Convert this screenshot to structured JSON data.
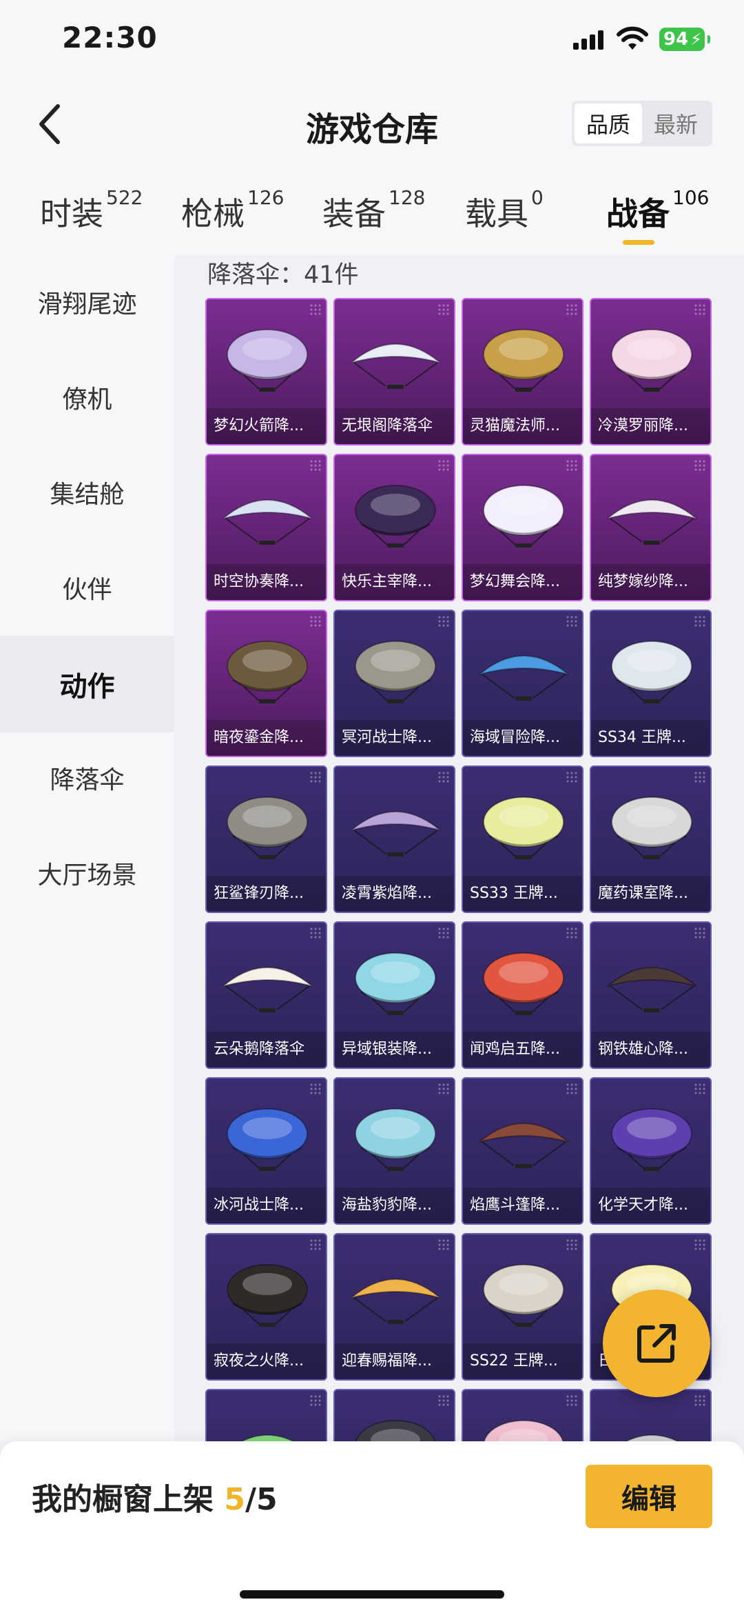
{
  "status": {
    "time": "22:30",
    "battery": "94"
  },
  "header": {
    "title": "游戏仓库",
    "sort_options": [
      "品质",
      "最新"
    ],
    "sort_active": 0
  },
  "tabs": [
    {
      "name": "时装",
      "count": "522"
    },
    {
      "name": "枪械",
      "count": "126"
    },
    {
      "name": "装备",
      "count": "128"
    },
    {
      "name": "载具",
      "count": "0"
    },
    {
      "name": "战备",
      "count": "106"
    }
  ],
  "active_tab": 4,
  "sidebar": {
    "items": [
      "滑翔尾迹",
      "僚机",
      "集结舱",
      "伙伴",
      "动作",
      "降落伞",
      "大厅场景"
    ],
    "active": 4
  },
  "content": {
    "heading": "降落伞：41件",
    "items": [
      {
        "name": "梦幻火箭降...",
        "tier": "purple",
        "icon": "parachute-icon"
      },
      {
        "name": "无垠阁降落伞",
        "tier": "purple",
        "icon": "parachute-icon"
      },
      {
        "name": "灵猫魔法师...",
        "tier": "purple",
        "icon": "parachute-icon"
      },
      {
        "name": "冷漠罗丽降...",
        "tier": "purple",
        "icon": "parachute-icon"
      },
      {
        "name": "时空协奏降...",
        "tier": "purple",
        "icon": "parachute-icon"
      },
      {
        "name": "快乐主宰降...",
        "tier": "purple",
        "icon": "parachute-icon"
      },
      {
        "name": "梦幻舞会降...",
        "tier": "purple",
        "icon": "parachute-icon"
      },
      {
        "name": "纯梦嫁纱降...",
        "tier": "purple",
        "icon": "parachute-icon"
      },
      {
        "name": "暗夜鎏金降...",
        "tier": "purple",
        "icon": "parachute-icon"
      },
      {
        "name": "冥河战士降...",
        "tier": "blue",
        "icon": "parachute-icon"
      },
      {
        "name": "海域冒险降...",
        "tier": "blue",
        "icon": "parachute-icon"
      },
      {
        "name": "SS34 王牌...",
        "tier": "blue",
        "icon": "parachute-icon"
      },
      {
        "name": "狂鲨锋刃降...",
        "tier": "blue",
        "icon": "parachute-icon"
      },
      {
        "name": "凌霄紫焰降...",
        "tier": "blue",
        "icon": "parachute-icon"
      },
      {
        "name": "SS33 王牌...",
        "tier": "blue",
        "icon": "parachute-icon"
      },
      {
        "name": "魔药课室降...",
        "tier": "blue",
        "icon": "parachute-icon"
      },
      {
        "name": "云朵鹅降落伞",
        "tier": "blue",
        "icon": "parachute-icon"
      },
      {
        "name": "异域银装降...",
        "tier": "blue",
        "icon": "parachute-icon"
      },
      {
        "name": "闻鸡启五降...",
        "tier": "blue",
        "icon": "parachute-icon"
      },
      {
        "name": "钢铁雄心降...",
        "tier": "blue",
        "icon": "parachute-icon"
      },
      {
        "name": "冰河战士降...",
        "tier": "blue",
        "icon": "parachute-icon"
      },
      {
        "name": "海盐豹豹降...",
        "tier": "blue",
        "icon": "parachute-icon"
      },
      {
        "name": "焰鹰斗篷降...",
        "tier": "blue",
        "icon": "parachute-icon"
      },
      {
        "name": "化学天才降...",
        "tier": "blue",
        "icon": "parachute-icon"
      },
      {
        "name": "寂夜之火降...",
        "tier": "blue",
        "icon": "parachute-icon"
      },
      {
        "name": "迎春赐福降...",
        "tier": "blue",
        "icon": "parachute-icon"
      },
      {
        "name": "SS22 王牌...",
        "tier": "blue",
        "icon": "parachute-icon"
      },
      {
        "name": "日",
        "tier": "blue",
        "icon": "parachute-icon"
      },
      {
        "name": "",
        "tier": "blue",
        "icon": "parachute-icon"
      },
      {
        "name": "",
        "tier": "blue",
        "icon": "parachute-icon"
      },
      {
        "name": "",
        "tier": "blue",
        "icon": "parachute-icon"
      },
      {
        "name": "",
        "tier": "blue",
        "icon": "parachute-icon"
      }
    ],
    "canopy_colors": [
      "#c7b6e8",
      "#e9eef6",
      "#c9a04a",
      "#f4d7e6",
      "#d8e4f2",
      "#3a2a55",
      "#f3eefc",
      "#efeaf1",
      "#6b5a3e",
      "#9b978c",
      "#4c9be0",
      "#dfe7ee",
      "#8f8c86",
      "#b9a3d9",
      "#e8ec9c",
      "#d6d9d6",
      "#f6f0e6",
      "#8fd6e6",
      "#e2553e",
      "#4b3a36",
      "#3a66d8",
      "#8fd2e3",
      "#8a4a3a",
      "#5e3fb0",
      "#2e2a28",
      "#f0b24a",
      "#d9d3c8",
      "#f6f0b6",
      "#7fd77a",
      "#3b3b46",
      "#f1c0cf",
      "#cfcfd3"
    ]
  },
  "fab": {
    "icon": "share-icon"
  },
  "bottom": {
    "showcase_label": "我的橱窗上架 ",
    "showcase_count": "5",
    "showcase_total": "/5",
    "edit_label": "编辑"
  },
  "colors": {
    "accent": "#f3b42f",
    "purple_card": "#7b2d92",
    "blue_card": "#3c2d72"
  }
}
